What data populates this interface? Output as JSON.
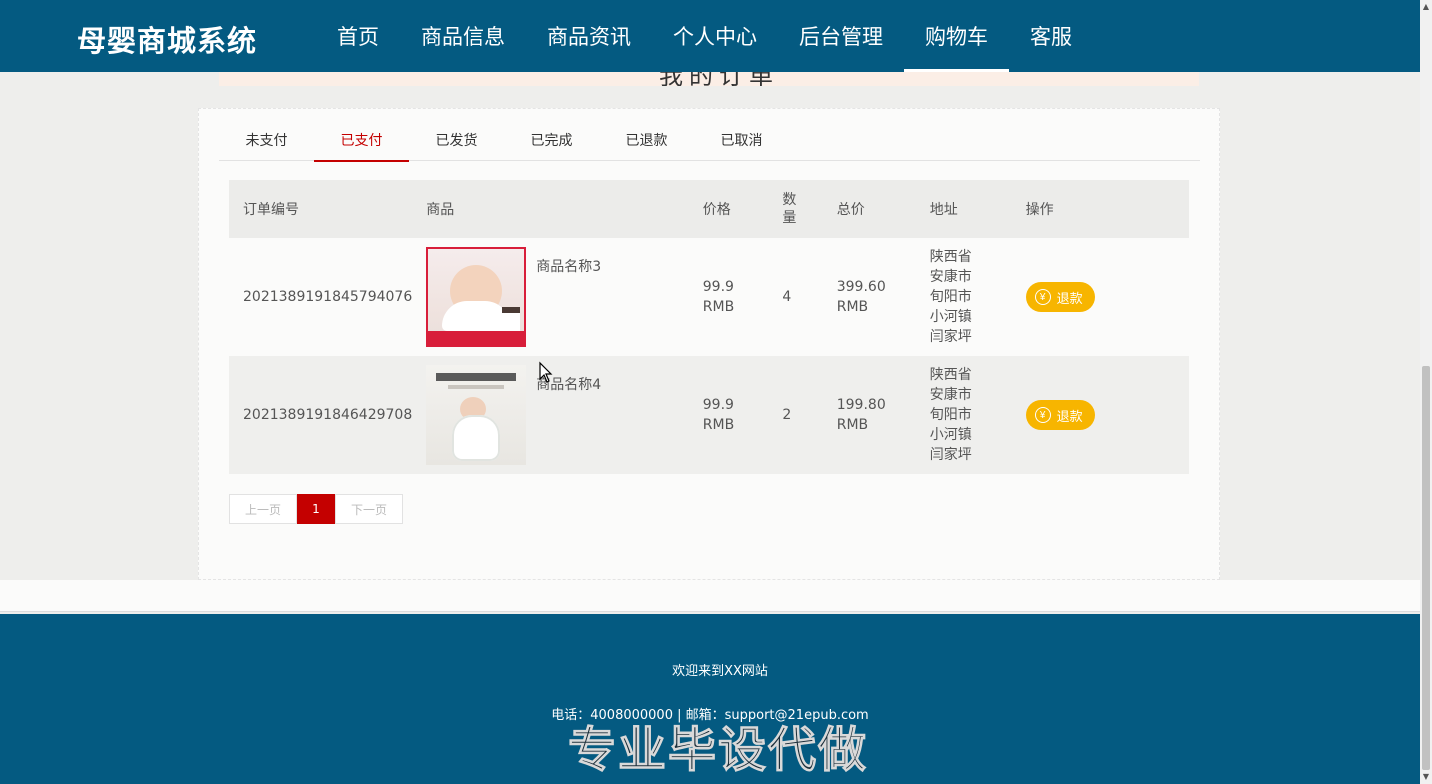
{
  "header": {
    "logo": "母婴商城系统",
    "nav": [
      "首页",
      "商品信息",
      "商品资讯",
      "个人中心",
      "后台管理",
      "购物车",
      "客服"
    ],
    "active_nav": "购物车"
  },
  "page_title": "我的订单",
  "tabs": [
    "未支付",
    "已支付",
    "已发货",
    "已完成",
    "已退款",
    "已取消"
  ],
  "active_tab": "已支付",
  "table": {
    "headers": [
      "订单编号",
      "商品",
      "价格",
      "数\n量",
      "总价",
      "地址",
      "操作"
    ],
    "rows": [
      {
        "order_no": "2021389191845794076",
        "product_name": "商品名称3",
        "price": "99.9 RMB",
        "qty": "4",
        "total": "399.60 RMB",
        "address": "陕西省安康市旬阳市小河镇闫家坪",
        "action": "退款"
      },
      {
        "order_no": "2021389191846429708",
        "product_name": "商品名称4",
        "price": "99.9 RMB",
        "qty": "2",
        "total": "199.80 RMB",
        "address": "陕西省安康市旬阳市小河镇闫家坪",
        "action": "退款"
      }
    ]
  },
  "pager": {
    "prev": "上一页",
    "current": "1",
    "next": "下一页"
  },
  "footer": {
    "welcome": "欢迎来到XX网站",
    "contact": "电话：4008000000 | 邮箱：support@21epub.com",
    "watermark": "专业毕设代做"
  },
  "colors": {
    "primary": "#045a81",
    "accent": "#c40000",
    "refund": "#f7b500"
  },
  "icons": {
    "refund_icon": "yen-icon"
  }
}
